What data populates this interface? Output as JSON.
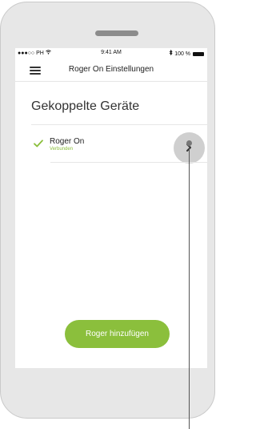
{
  "status_bar": {
    "carrier": "●●●○○ PH",
    "time": "9:41 AM",
    "battery": "100 %"
  },
  "header": {
    "title": "Roger On Einstellungen"
  },
  "main": {
    "section_title": "Gekoppelte Geräte",
    "devices": [
      {
        "name": "Roger On",
        "status": "Verbunden"
      }
    ],
    "add_button_label": "Roger hinzufügen"
  },
  "colors": {
    "accent": "#8bbf3c",
    "chevron_bg": "#cfcfcf",
    "phone_bg": "#e7e7e7"
  },
  "icons": {
    "menu": "hamburger-menu-icon",
    "connected": "checkmark-icon",
    "open_device": "chevron-right-icon",
    "wifi": "wifi-icon",
    "bluetooth": "bluetooth-icon",
    "battery": "battery-icon"
  }
}
